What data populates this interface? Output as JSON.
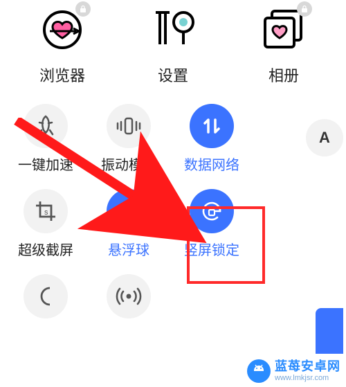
{
  "apps": [
    {
      "id": "browser",
      "label": "浏览器",
      "icon": "heart-target-icon",
      "locked": true
    },
    {
      "id": "settings",
      "label": "设置",
      "icon": "cutlery-icon",
      "locked": false
    },
    {
      "id": "gallery",
      "label": "相册",
      "icon": "photo-stack-icon",
      "locked": true
    }
  ],
  "tiles": {
    "row1": [
      {
        "id": "boost",
        "label": "一键加速",
        "icon": "rocket-icon",
        "active": false
      },
      {
        "id": "vibrate",
        "label": "振动模式",
        "icon": "vibrate-icon",
        "active": false
      },
      {
        "id": "data",
        "label": "数据网络",
        "icon": "data-arrows-icon",
        "active": true
      }
    ],
    "row2": [
      {
        "id": "screenshot",
        "label": "超级截屏",
        "icon": "crop-icon",
        "active": false
      },
      {
        "id": "floatball",
        "label": "悬浮球",
        "icon": "target-circle-icon",
        "active": true
      },
      {
        "id": "rotationlock",
        "label": "竖屏锁定",
        "icon": "rotation-lock-icon",
        "active": true
      }
    ],
    "row3": [
      {
        "id": "dnd",
        "label": "",
        "icon": "moon-icon",
        "active": false
      },
      {
        "id": "hotspot",
        "label": "",
        "icon": "hotspot-icon",
        "active": false
      },
      {
        "id": "more",
        "label": "",
        "icon": "chevron-icon",
        "active": false
      }
    ]
  },
  "edit_button": {
    "label": "A"
  },
  "watermark": {
    "title": "蓝苺安卓网",
    "url": "www.lmkjsr.com"
  },
  "highlight_target": "rotationlock",
  "colors": {
    "accent_blue": "#3b73ff",
    "highlight_red": "#ff2a2a",
    "tile_gray": "#f2f2f2",
    "watermark_blue": "#2a8cff"
  }
}
